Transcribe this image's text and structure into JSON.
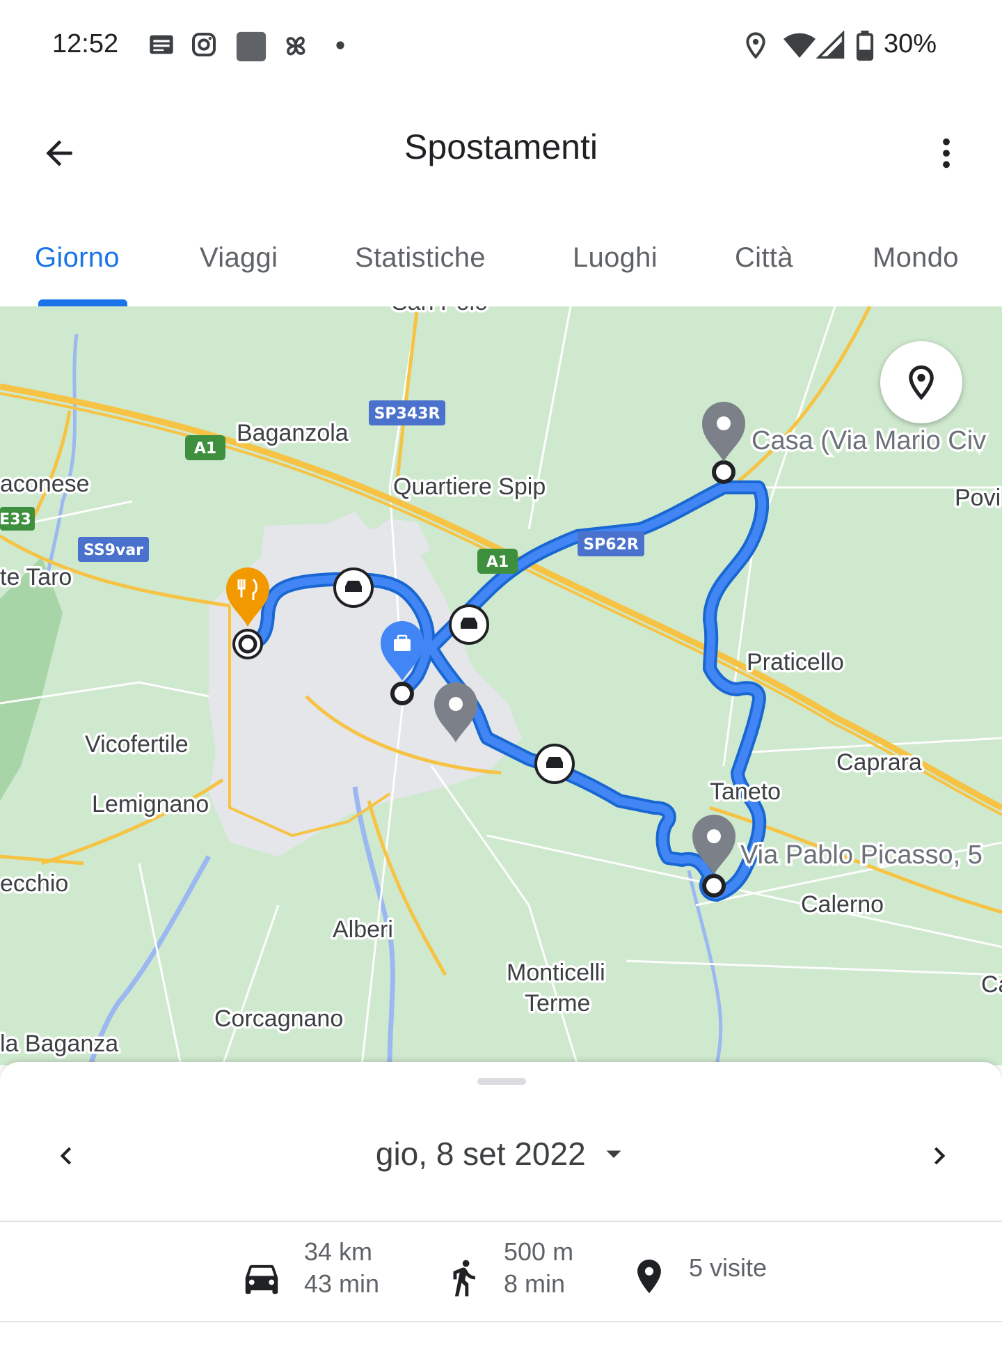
{
  "status_bar": {
    "time": "12:52",
    "battery": "30%",
    "icons": [
      "news-icon",
      "instagram-icon",
      "app-square-icon",
      "fan-icon",
      "dot-icon",
      "location-icon",
      "wifi-icon",
      "signal-icon",
      "battery-icon"
    ]
  },
  "app_bar": {
    "title": "Spostamenti",
    "back_icon": "arrow-back-icon",
    "more_icon": "more-vert-icon"
  },
  "tabs": [
    {
      "label": "Giorno",
      "active": true
    },
    {
      "label": "Viaggi",
      "active": false
    },
    {
      "label": "Statistiche",
      "active": false
    },
    {
      "label": "Luoghi",
      "active": false
    },
    {
      "label": "Città",
      "active": false
    },
    {
      "label": "Mondo",
      "active": false
    }
  ],
  "map": {
    "labels": {
      "san_polo": "San Polo",
      "baganzola": "Baganzola",
      "quartiere_spip": "Quartiere Spip",
      "roncopascolo": "aconese",
      "ponte_taro": "te Taro",
      "vicofertile": "Vicofertile",
      "lemignano": "Lemignano",
      "vecchio": "ecchio",
      "alberi": "Alberi",
      "monticelli_1": "Monticelli",
      "monticelli_2": "Terme",
      "corcagnano": "Corcagnano",
      "baganza": "la Baganza",
      "praticello": "Praticello",
      "caprara": "Caprara",
      "taneto": "Taneto",
      "calerno": "Calerno",
      "povi": "Povi",
      "edge_c": "Ca",
      "casa": "Casa (Via Mario Civ",
      "picasso": "Via Pablo Picasso, 5"
    },
    "shields": {
      "sp343r": "SP343R",
      "a1_west": "A1",
      "a1_east": "A1",
      "e33": "E33",
      "ss9var": "SS9var",
      "sp62r": "SP62R"
    },
    "colors": {
      "route": "#4285f4",
      "route_outline": "#1967d2",
      "restaurant_pin": "#f29900",
      "work_pin": "#4285f4",
      "place_pin": "#7b8089",
      "highway": "#f6c344",
      "green": "#cfe9cf",
      "urban": "#e4e6ea",
      "water": "#9bb8f1"
    },
    "locate_icon": "location-pin-icon"
  },
  "day_panel": {
    "date": "gio, 8 set 2022",
    "prev_icon": "chevron-left-icon",
    "next_icon": "chevron-right-icon",
    "dropdown_icon": "arrow-drop-down-icon",
    "stats": {
      "driving": {
        "distance": "34 km",
        "duration": "43 min",
        "icon": "car-icon"
      },
      "walking": {
        "distance": "500 m",
        "duration": "8 min",
        "icon": "walk-icon"
      },
      "visits": {
        "label": "5 visite",
        "icon": "place-icon"
      }
    }
  }
}
